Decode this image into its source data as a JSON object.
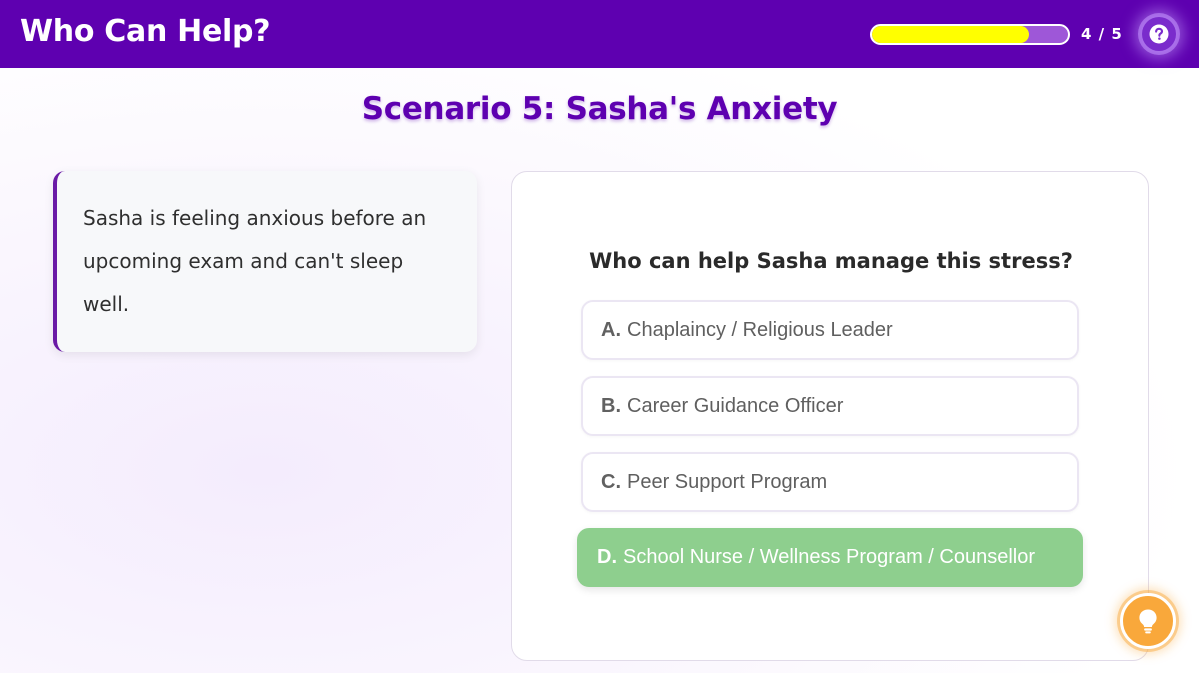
{
  "header": {
    "title": "Who Can Help?",
    "progress": {
      "fraction": 0.8,
      "counter_text": "4 / 5",
      "fill_color": "#ffff00",
      "track_color": "#9e57d8"
    },
    "help_icon": "question-circle-icon"
  },
  "scenario": {
    "title": "Scenario 5: Sasha's Anxiety",
    "description": "Sasha is feeling anxious before an upcoming exam and can't sleep well."
  },
  "question": {
    "prompt": "Who can help Sasha manage this stress?",
    "options": [
      {
        "letter": "A.",
        "label": "Chaplaincy / Religious Leader",
        "selected": false
      },
      {
        "letter": "B.",
        "label": "Career Guidance Officer",
        "selected": false
      },
      {
        "letter": "C.",
        "label": "Peer Support Program",
        "selected": false
      },
      {
        "letter": "D.",
        "label": "School Nurse / Wellness Program / Counsellor",
        "selected": true
      }
    ]
  },
  "hint": {
    "icon": "lightbulb-icon"
  },
  "colors": {
    "brand": "#5e00b0",
    "selected_option": "#8ecf8e",
    "hint": "#f9a83b"
  }
}
